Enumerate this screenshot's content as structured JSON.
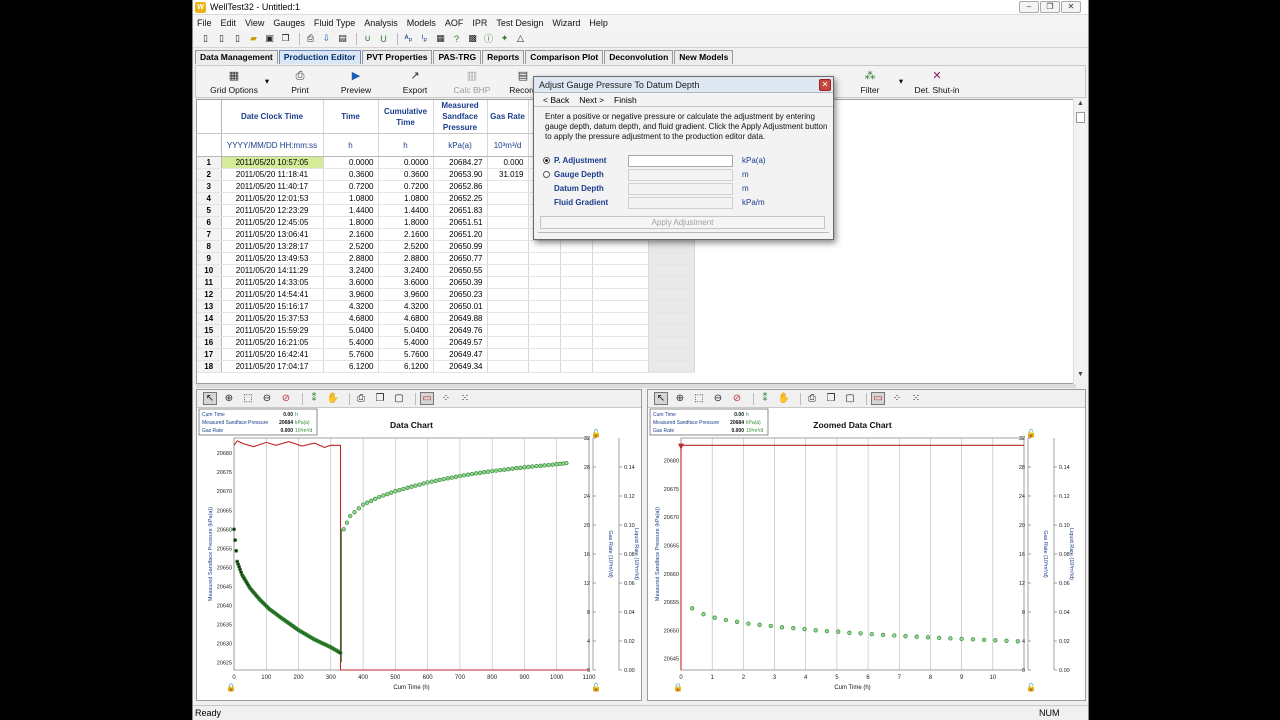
{
  "window": {
    "title": "WellTest32 - Untitled:1",
    "icon_label": "W",
    "controls": [
      "minimize-icon",
      "maximize-icon",
      "close-icon"
    ]
  },
  "menu": [
    "File",
    "Edit",
    "View",
    "Gauges",
    "Fluid Type",
    "Analysis",
    "Models",
    "AOF",
    "IPR",
    "Test Design",
    "Wizard",
    "Help"
  ],
  "tabs": [
    {
      "label": "Data Management",
      "active": false
    },
    {
      "label": "Production Editor",
      "active": true
    },
    {
      "label": "PVT Properties",
      "active": false
    },
    {
      "label": "PAS-TRG",
      "active": false
    },
    {
      "label": "Reports",
      "active": false
    },
    {
      "label": "Comparison Plot",
      "active": false
    },
    {
      "label": "Deconvolution",
      "active": false
    },
    {
      "label": "New Models",
      "active": false
    }
  ],
  "ribbon": {
    "grid_options": "Grid Options",
    "print": "Print",
    "preview": "Preview",
    "export": "Export",
    "calc_bhp": "Calc BHP",
    "record": "Record",
    "filter": "Filter",
    "det_shutin": "Det. Shut-in"
  },
  "grid": {
    "headers": [
      "Date Clock Time",
      "Time",
      "Cumulative Time",
      "Measured Sandface Pressure",
      "Gas Rate"
    ],
    "units": [
      "YYYY/MM/DD HH:mm:ss",
      "h",
      "h",
      "kPa(a)",
      "10³m³/d"
    ],
    "rows": [
      [
        "1",
        "2011/05/20 10:57:05",
        "0.0000",
        "0.0000",
        "20684.27",
        "0.000"
      ],
      [
        "2",
        "2011/05/20 11:18:41",
        "0.3600",
        "0.3600",
        "20653.90",
        "31.019"
      ],
      [
        "3",
        "2011/05/20 11:40:17",
        "0.7200",
        "0.7200",
        "20652.86",
        ""
      ],
      [
        "4",
        "2011/05/20 12:01:53",
        "1.0800",
        "1.0800",
        "20652.25",
        ""
      ],
      [
        "5",
        "2011/05/20 12:23:29",
        "1.4400",
        "1.4400",
        "20651.83",
        ""
      ],
      [
        "6",
        "2011/05/20 12:45:05",
        "1.8000",
        "1.8000",
        "20651.51",
        ""
      ],
      [
        "7",
        "2011/05/20 13:06:41",
        "2.1600",
        "2.1600",
        "20651.20",
        ""
      ],
      [
        "8",
        "2011/05/20 13:28:17",
        "2.5200",
        "2.5200",
        "20650.99",
        ""
      ],
      [
        "9",
        "2011/05/20 13:49:53",
        "2.8800",
        "2.8800",
        "20650.77",
        ""
      ],
      [
        "10",
        "2011/05/20 14:11:29",
        "3.2400",
        "3.2400",
        "20650.55",
        ""
      ],
      [
        "11",
        "2011/05/20 14:33:05",
        "3.6000",
        "3.6000",
        "20650.39",
        ""
      ],
      [
        "12",
        "2011/05/20 14:54:41",
        "3.9600",
        "3.9600",
        "20650.23",
        ""
      ],
      [
        "13",
        "2011/05/20 15:16:17",
        "4.3200",
        "4.3200",
        "20650.01",
        ""
      ],
      [
        "14",
        "2011/05/20 15:37:53",
        "4.6800",
        "4.6800",
        "20649.88",
        ""
      ],
      [
        "15",
        "2011/05/20 15:59:29",
        "5.0400",
        "5.0400",
        "20649.76",
        ""
      ],
      [
        "16",
        "2011/05/20 16:21:05",
        "5.4000",
        "5.4000",
        "20649.57",
        ""
      ],
      [
        "17",
        "2011/05/20 16:42:41",
        "5.7600",
        "5.7600",
        "20649.47",
        ""
      ],
      [
        "18",
        "2011/05/20 17:04:17",
        "6.1200",
        "6.1200",
        "20649.34",
        ""
      ]
    ]
  },
  "dialog": {
    "title": "Adjust Gauge Pressure To Datum Depth",
    "nav": [
      "< Back",
      "Next >",
      "Finish"
    ],
    "description": "Enter a positive or negative pressure or calculate the adjustment by entering gauge depth, datum depth, and fluid gradient.  Click the Apply Adjustment button to apply the pressure adjustment to the production editor data.",
    "fields": [
      {
        "label": "P. Adjustment",
        "unit": "kPa(a)",
        "value": "",
        "radio": true,
        "selected": true
      },
      {
        "label": "Gauge Depth",
        "unit": "m",
        "value": "",
        "radio": true,
        "selected": false
      },
      {
        "label": "Datum Depth",
        "unit": "m",
        "value": "",
        "radio": false,
        "selected": false
      },
      {
        "label": "Fluid Gradient",
        "unit": "kPa/m",
        "value": "",
        "radio": false,
        "selected": false
      }
    ],
    "apply_label": "Apply Adjustment"
  },
  "chart_data": [
    {
      "type": "scatter",
      "title": "Data Chart",
      "xlabel": "Cum Time (h)",
      "ylabel": "Measured Sandface Pressure (kPa(a))",
      "y2label": "Gas Rate (10³m³/d)",
      "y3label": "Liquid Rate (10³m³/d)",
      "xlim": [
        0,
        1100
      ],
      "xticks": [
        0,
        100,
        200,
        300,
        400,
        500,
        600,
        700,
        800,
        900,
        1000,
        1100
      ],
      "ylim": [
        20623,
        20684
      ],
      "yticks": [
        20625,
        20630,
        20635,
        20640,
        20645,
        20650,
        20655,
        20660,
        20665,
        20670,
        20675,
        20680
      ],
      "y2lim": [
        0,
        32
      ],
      "y2ticks": [
        0,
        4,
        8,
        12,
        16,
        20,
        24,
        28,
        32
      ],
      "y3lim": [
        0,
        0.16
      ],
      "y3ticks": [
        0.0,
        0.02,
        0.04,
        0.06,
        0.08,
        0.1,
        0.12,
        0.14
      ],
      "readout": [
        {
          "label": "Cum Time",
          "value": "0.00",
          "unit": "h"
        },
        {
          "label": "Measured Sandface Pressure",
          "value": "20684",
          "unit": "kPa(a)"
        },
        {
          "label": "Gas Rate",
          "value": "0.000",
          "unit": "10³m³/d"
        }
      ],
      "series": [
        {
          "name": "Measured Sandface Pressure",
          "color": "#2f8f2f",
          "x": [
            0,
            10,
            25,
            50,
            80,
            110,
            150,
            200,
            250,
            300,
            320,
            330,
            340,
            360,
            400,
            450,
            500,
            550,
            600,
            650,
            700,
            750,
            800,
            850,
            900,
            950,
            1000,
            1030
          ],
          "y": [
            20660,
            20651.5,
            20648,
            20644.5,
            20641.5,
            20639,
            20636.5,
            20633.5,
            20631,
            20629,
            20628,
            20627.5,
            20660,
            20663.5,
            20666.5,
            20668.5,
            20670,
            20671.2,
            20672.3,
            20673.2,
            20674,
            20674.7,
            20675.3,
            20675.8,
            20676.3,
            20676.7,
            20677.1,
            20677.4
          ]
        },
        {
          "name": "Gas Rate",
          "color": "#c0262d",
          "step_x": [
            0,
            10,
            30,
            60,
            100,
            130,
            170,
            210,
            250,
            280,
            300,
            330,
            330,
            1100
          ],
          "step_y": [
            31.0,
            31.6,
            31.2,
            30.8,
            31.4,
            31.0,
            31.5,
            30.9,
            31.3,
            30.7,
            31.0,
            31.0,
            0,
            0
          ]
        }
      ]
    },
    {
      "type": "scatter",
      "title": "Zoomed Data Chart",
      "xlabel": "Cum Time (h)",
      "ylabel": "Measured Sandface Pressure (kPa(a))",
      "y2label": "Gas Rate (10³m³/d)",
      "y3label": "Liquid Rate (10³m³/d)",
      "xlim": [
        0,
        11
      ],
      "xticks": [
        0,
        1,
        2,
        3,
        4,
        5,
        6,
        7,
        8,
        9,
        10
      ],
      "ylim": [
        20643,
        20684
      ],
      "yticks": [
        20645,
        20650,
        20655,
        20660,
        20665,
        20670,
        20675,
        20680
      ],
      "y2lim": [
        0,
        32
      ],
      "y2ticks": [
        0,
        4,
        8,
        12,
        16,
        20,
        24,
        28,
        32
      ],
      "y3lim": [
        0,
        0.16
      ],
      "y3ticks": [
        0.0,
        0.02,
        0.04,
        0.06,
        0.08,
        0.1,
        0.12,
        0.14
      ],
      "readout": [
        {
          "label": "Cum Time",
          "value": "0.00",
          "unit": "h"
        },
        {
          "label": "Measured Sandface Pressure",
          "value": "20684",
          "unit": "kPa(a)"
        },
        {
          "label": "Gas Rate",
          "value": "0.000",
          "unit": "10³m³/d"
        }
      ],
      "series": [
        {
          "name": "Measured Sandface Pressure",
          "color": "#2f8f2f",
          "x": [
            0.36,
            0.72,
            1.08,
            1.44,
            1.8,
            2.16,
            2.52,
            2.88,
            3.24,
            3.6,
            3.96,
            4.32,
            4.68,
            5.04,
            5.4,
            5.76,
            6.12,
            6.48,
            6.84,
            7.2,
            7.56,
            7.92,
            8.28,
            8.64,
            9.0,
            9.36,
            9.72,
            10.08,
            10.44,
            10.8
          ],
          "y": [
            20653.9,
            20652.86,
            20652.25,
            20651.83,
            20651.51,
            20651.2,
            20650.99,
            20650.77,
            20650.55,
            20650.39,
            20650.23,
            20650.01,
            20649.88,
            20649.76,
            20649.57,
            20649.47,
            20649.34,
            20649.2,
            20649.1,
            20648.98,
            20648.88,
            20648.78,
            20648.67,
            20648.58,
            20648.49,
            20648.4,
            20648.32,
            20648.24,
            20648.16,
            20648.08
          ]
        },
        {
          "name": "Gas Rate",
          "color": "#c0262d",
          "step_x": [
            0,
            0,
            11
          ],
          "step_y": [
            0,
            31.0,
            31.0
          ]
        }
      ]
    }
  ],
  "status": {
    "left": "Ready",
    "right": "NUM"
  },
  "colors": {
    "accent": "#1a3d8c",
    "selected_row": "#d4ec9a",
    "tab_active": "#dbe6f4"
  }
}
